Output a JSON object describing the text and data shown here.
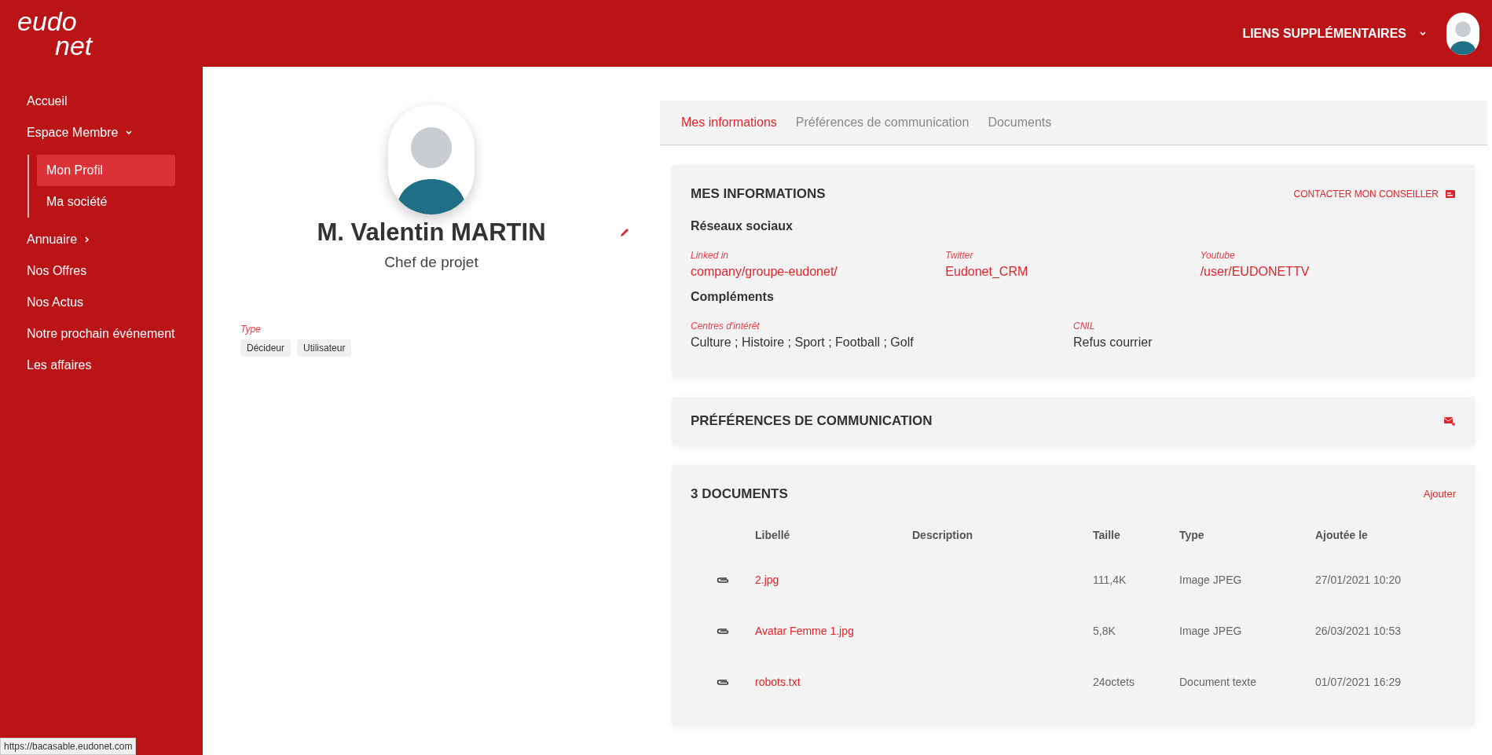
{
  "header": {
    "logo_top": "eudo",
    "logo_bottom": "net",
    "links_menu": "LIENS SUPPLÉMENTAIRES"
  },
  "sidebar": {
    "items": [
      {
        "label": "Accueil",
        "kind": "link",
        "selected": false
      },
      {
        "label": "Espace Membre",
        "kind": "group",
        "expanded": true,
        "selected": false,
        "children": [
          {
            "label": "Mon Profil",
            "selected": true
          },
          {
            "label": "Ma société",
            "selected": false
          }
        ]
      },
      {
        "label": "Annuaire",
        "kind": "group",
        "expanded": false,
        "selected": false
      },
      {
        "label": "Nos Offres",
        "kind": "link",
        "selected": false
      },
      {
        "label": "Nos Actus",
        "kind": "link",
        "selected": false
      },
      {
        "label": "Notre prochain événement",
        "kind": "link",
        "selected": false
      },
      {
        "label": "Les affaires",
        "kind": "link",
        "selected": false
      }
    ]
  },
  "profile": {
    "name": "M. Valentin MARTIN",
    "role": "Chef de projet",
    "type_label": "Type",
    "types": [
      "Décideur",
      "Utilisateur"
    ]
  },
  "tabs": [
    {
      "label": "Mes informations",
      "selected": true
    },
    {
      "label": "Préférences de communication",
      "selected": false
    },
    {
      "label": "Documents",
      "selected": false
    }
  ],
  "mes_informations": {
    "title": "MES INFORMATIONS",
    "contact_link": "CONTACTER MON CONSEILLER",
    "sections": [
      {
        "title": "Réseaux sociaux",
        "kind": "link",
        "fields": [
          {
            "label": "Linked in",
            "value": "company/groupe-eudonet/"
          },
          {
            "label": "Twitter",
            "value": "Eudonet_CRM"
          },
          {
            "label": "Youtube",
            "value": "/user/EUDONETTV"
          }
        ]
      },
      {
        "title": "Compléments",
        "kind": "text",
        "fields": [
          {
            "label": "Centres d'intérêt",
            "value": "Culture ; Histoire ; Sport ; Football ; Golf"
          },
          {
            "label": "CNIL",
            "value": "Refus courrier"
          }
        ]
      }
    ]
  },
  "preferences": {
    "title": "PRÉFÉRENCES DE COMMUNICATION"
  },
  "documents": {
    "title": "3 DOCUMENTS",
    "add_link": "Ajouter",
    "columns": [
      "Libellé",
      "Description",
      "Taille",
      "Type",
      "Ajoutée le"
    ],
    "rows": [
      {
        "name": "2.jpg",
        "size": "111,4K",
        "type": "Image JPEG",
        "date": "27/01/2021 10:20"
      },
      {
        "name": "Avatar Femme 1.jpg",
        "size": "5,8K",
        "type": "Image JPEG",
        "date": "26/03/2021 10:53"
      },
      {
        "name": "robots.txt",
        "size": "24octets",
        "type": "Document texte",
        "date": "01/07/2021 16:29"
      }
    ]
  },
  "status_url": "https://bacasable.eudonet.com"
}
